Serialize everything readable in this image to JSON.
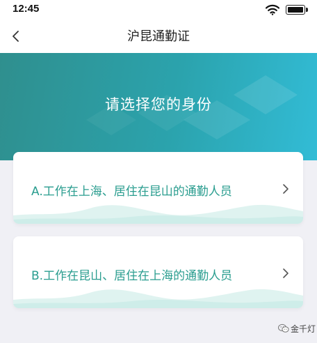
{
  "status_bar": {
    "time": "12:45",
    "wifi_icon": "wifi-icon",
    "battery_icon": "battery-icon"
  },
  "nav": {
    "title": "沪昆通勤证",
    "back_icon": "chevron-left-icon"
  },
  "hero": {
    "title": "请选择您的身份",
    "colors": [
      "#2f8f8e",
      "#32bcd6"
    ]
  },
  "options": [
    {
      "label": "A.工作在上海、居住在昆山的通勤人员",
      "icon": "chevron-right-icon"
    },
    {
      "label": "B.工作在昆山、居住在上海的通勤人员",
      "icon": "chevron-right-icon"
    }
  ],
  "watermark": {
    "text": "金千灯",
    "icon": "wechat-icon"
  },
  "colors": {
    "accent": "#2a9d8f",
    "background": "#f0f0f5"
  }
}
